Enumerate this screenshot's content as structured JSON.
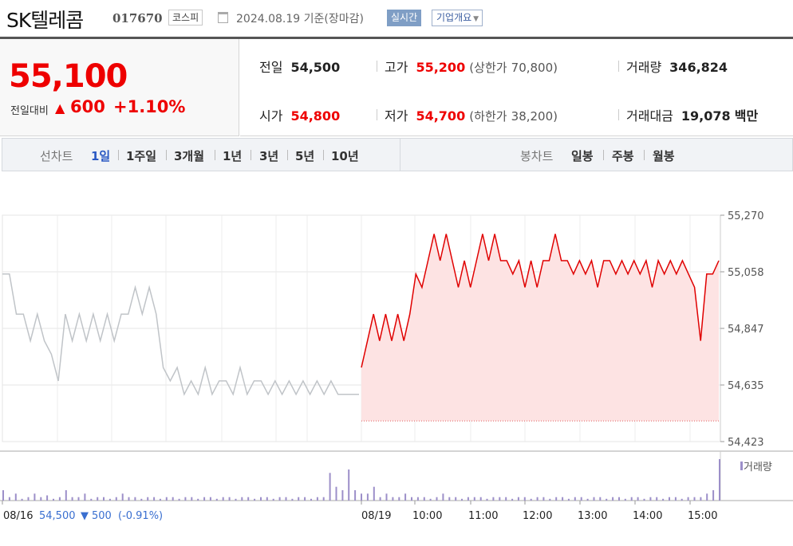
{
  "header": {
    "name": "SK텔레콤",
    "code": "017670",
    "market": "코스피",
    "date": "2024.08.19  기준(장마감)",
    "live_button": "실시간",
    "overview_button": "기업개요"
  },
  "price": {
    "current": "55,100",
    "change_label": "전일대비",
    "change_arrow": "▲",
    "change": "600",
    "change_pct": "+1.10%"
  },
  "stats": {
    "prev_close": {
      "label": "전일",
      "value": "54,500"
    },
    "high": {
      "label": "고가",
      "value": "55,200",
      "limit_label": "(상한가",
      "limit_value": "70,800)"
    },
    "volume": {
      "label": "거래량",
      "value": "346,824"
    },
    "open": {
      "label": "시가",
      "value": "54,800"
    },
    "low": {
      "label": "저가",
      "value": "54,700",
      "limit_label": "(하한가",
      "limit_value": "38,200)"
    },
    "trade_amount": {
      "label": "거래대금",
      "value": "19,078",
      "unit": "백만"
    }
  },
  "period_nav": {
    "line_label": "선차트",
    "line_items": [
      "1일",
      "1주일",
      "3개월",
      "1년",
      "3년",
      "5년",
      "10년"
    ],
    "candle_label": "봉차트",
    "candle_items": [
      "일봉",
      "주봉",
      "월봉"
    ]
  },
  "colors": {
    "up": "#e00000",
    "down": "#2b59c3",
    "prev_day_line": "#c0c4c8",
    "area_fill": "#fde3e3",
    "volume_bar": "#9c8fc9"
  },
  "chart_data": {
    "type": "line",
    "y_ticks": [
      "55,270",
      "55,058",
      "54,847",
      "54,635",
      "54,423"
    ],
    "ylim": [
      54423,
      55270
    ],
    "x_labels": [
      "08/16",
      "08/19",
      "10:00",
      "11:00",
      "12:00",
      "13:00",
      "14:00",
      "15:00"
    ],
    "prev_day_info": {
      "close": "54,500",
      "change": "500",
      "change_pct": "(-0.91%)"
    },
    "volume_legend": "거래량",
    "baseline": 54500,
    "series": [
      {
        "name": "08/16",
        "values": [
          55050,
          55050,
          54900,
          54900,
          54800,
          54900,
          54800,
          54750,
          54650,
          54900,
          54800,
          54900,
          54800,
          54900,
          54800,
          54900,
          54800,
          54900,
          54900,
          55000,
          54900,
          55000,
          54900,
          54700,
          54650,
          54700,
          54600,
          54650,
          54600,
          54700,
          54600,
          54650,
          54650,
          54600,
          54700,
          54600,
          54650,
          54650,
          54600,
          54650,
          54600,
          54650,
          54600,
          54650,
          54600,
          54650,
          54600,
          54650,
          54600,
          54600,
          54600,
          54600
        ]
      },
      {
        "name": "08/19",
        "values": [
          54700,
          54800,
          54900,
          54800,
          54900,
          54800,
          54900,
          54800,
          54900,
          55050,
          55000,
          55100,
          55200,
          55100,
          55200,
          55100,
          55000,
          55100,
          55000,
          55100,
          55200,
          55100,
          55200,
          55100,
          55100,
          55050,
          55100,
          55000,
          55100,
          55000,
          55100,
          55100,
          55200,
          55100,
          55100,
          55050,
          55100,
          55050,
          55100,
          55000,
          55100,
          55100,
          55050,
          55100,
          55050,
          55100,
          55050,
          55100,
          55000,
          55100,
          55050,
          55100,
          55050,
          55100,
          55050,
          55000,
          54800,
          55050,
          55050,
          55100
        ]
      }
    ],
    "volume": [
      3,
      1,
      2,
      0.5,
      1,
      2,
      1,
      1.5,
      0.5,
      1,
      3,
      1,
      1,
      2,
      0.5,
      1,
      1,
      0.5,
      1,
      2,
      1,
      1,
      0.5,
      1,
      1,
      0.5,
      1,
      1,
      0.5,
      1,
      1,
      0.5,
      1,
      1,
      0.5,
      1,
      1,
      0.5,
      1,
      1,
      0.5,
      1,
      1,
      0.5,
      1,
      1,
      0.5,
      1,
      1,
      0.5,
      1,
      1,
      8,
      4,
      3,
      9,
      3,
      2,
      2,
      4,
      1,
      2,
      1,
      1,
      2,
      1,
      1,
      1,
      0.5,
      1,
      2,
      1,
      1,
      0.5,
      1,
      1,
      1,
      0.5,
      1,
      1,
      1,
      0.5,
      1,
      1,
      0.5,
      1,
      1,
      0.5,
      1,
      1,
      0.5,
      1,
      1,
      0.5,
      1,
      1,
      0.5,
      1,
      1,
      0.5,
      1,
      1,
      0.5,
      1,
      1,
      0.5,
      1,
      1,
      0.5,
      1,
      1,
      1,
      2,
      3,
      12
    ]
  }
}
